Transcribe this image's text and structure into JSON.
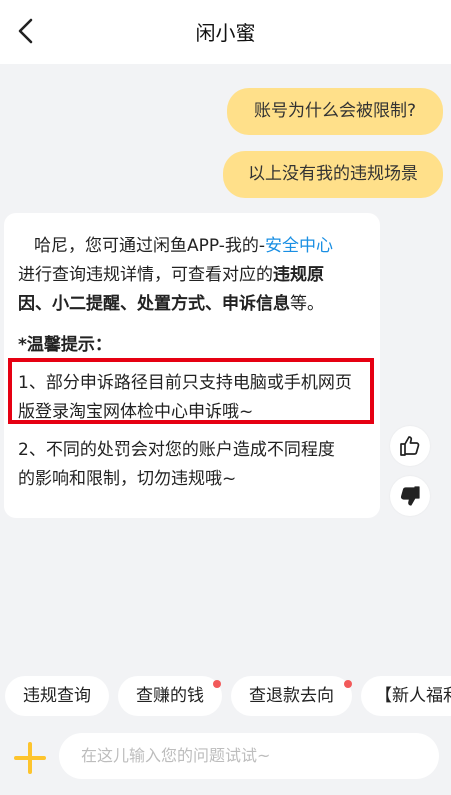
{
  "header": {
    "title": "闲小蜜",
    "back_icon": "chevron-left-icon"
  },
  "conversation": {
    "user_messages": [
      "账号为什么会被限制?",
      "以上没有我的违规场景"
    ],
    "bot_reply": {
      "intro_prefix": "哈尼，您可通过闲鱼APP-我的-",
      "intro_link": "安全中心",
      "line2_prefix": "进行查询违规详情，可查看对应的",
      "line2_bold": "违规原",
      "line3_bold": "因、小二提醒、处置方式、申诉信息",
      "line3_suffix": "等。",
      "tip_title": "*温馨提示：",
      "tip1_line1": "1、部分申诉路径目前只支持电脑或手机网页",
      "tip1_line2": "版登录淘宝网体检中心申诉哦~",
      "tip2_line1": "2、不同的处罚会对您的账户造成不同程度",
      "tip2_line2": "的影响和限制，切勿违规哦~"
    },
    "link_color": "#1a8fe3",
    "highlight_color": "#e60012"
  },
  "feedback": {
    "like_icon": "thumbs-up-icon",
    "dislike_icon": "thumbs-down-icon"
  },
  "quick_chips": [
    {
      "label": "违规查询",
      "has_dot": false
    },
    {
      "label": "查赚的钱",
      "has_dot": true
    },
    {
      "label": "查退款去向",
      "has_dot": true
    },
    {
      "label": "【新人福利",
      "has_dot": false
    }
  ],
  "input": {
    "placeholder": "在这儿输入您的问题试试~",
    "plus_icon": "plus-icon"
  },
  "colors": {
    "user_bubble": "#ffe08a",
    "accent": "#fdc42d",
    "background": "#f2f3f5",
    "badge": "#f25a5a"
  }
}
